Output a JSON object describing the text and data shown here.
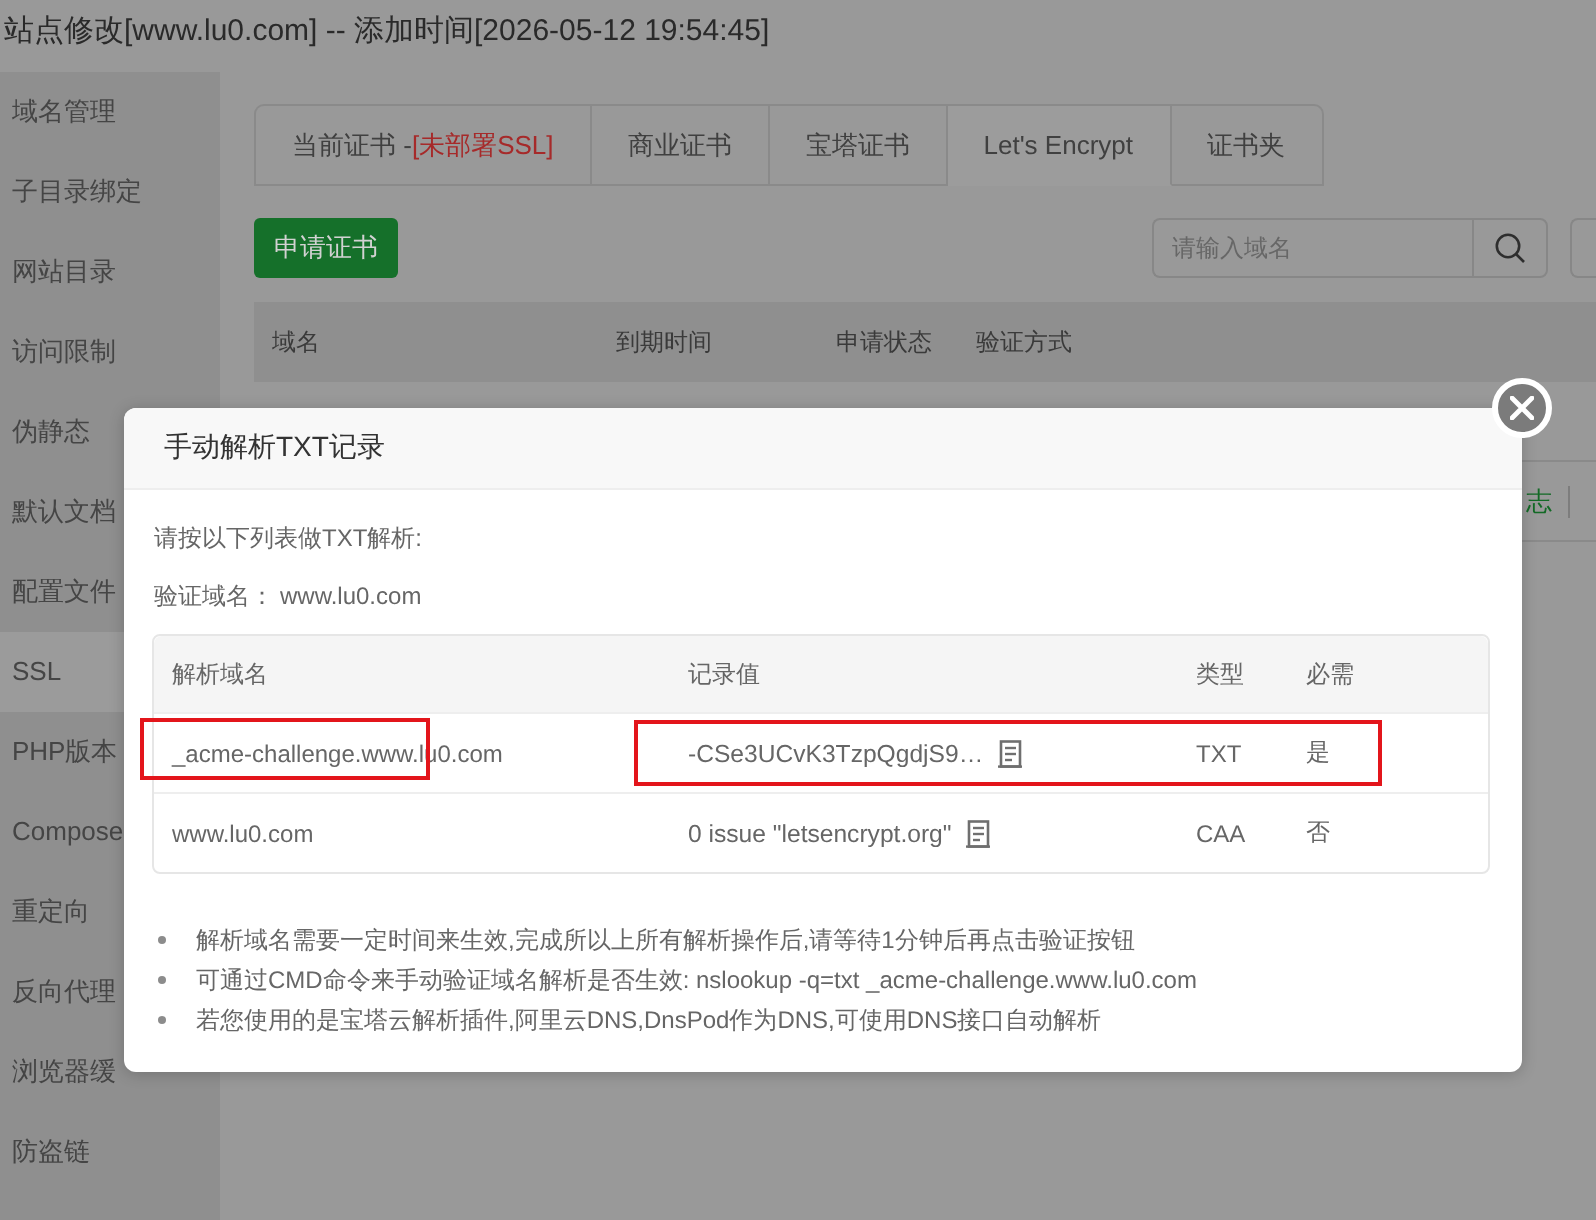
{
  "window": {
    "title": "站点修改[www.lu0.com] -- 添加时间[2026-05-12 19:54:45]"
  },
  "sidebar": {
    "items": [
      {
        "label": "域名管理",
        "selected": false
      },
      {
        "label": "子目录绑定",
        "selected": false
      },
      {
        "label": "网站目录",
        "selected": false
      },
      {
        "label": "访问限制",
        "selected": false
      },
      {
        "label": "伪静态",
        "selected": false
      },
      {
        "label": "默认文档",
        "selected": false
      },
      {
        "label": "配置文件",
        "selected": false
      },
      {
        "label": "SSL",
        "selected": true
      },
      {
        "label": "PHP版本",
        "selected": false
      },
      {
        "label": "Compose",
        "selected": false
      },
      {
        "label": "重定向",
        "selected": false
      },
      {
        "label": "反向代理",
        "selected": false
      },
      {
        "label": "浏览器缓",
        "selected": false
      },
      {
        "label": "防盗链",
        "selected": false
      }
    ]
  },
  "tabs": [
    {
      "label": "当前证书 -",
      "note": "[未部署SSL]",
      "selected": false
    },
    {
      "label": "商业证书",
      "selected": false
    },
    {
      "label": "宝塔证书",
      "selected": false
    },
    {
      "label": "Let's Encrypt",
      "selected": true
    },
    {
      "label": "证书夹",
      "selected": false
    }
  ],
  "toolbar": {
    "apply_button": "申请证书",
    "search": {
      "placeholder": "请输入域名"
    }
  },
  "table": {
    "columns": [
      "域名",
      "到期时间",
      "申请状态",
      "验证方式"
    ],
    "rows": [
      {
        "kind": "blank"
      },
      {
        "kind": "link",
        "text": "志"
      }
    ]
  },
  "dialog": {
    "title": "手动解析TXT记录",
    "intro": "请按以下列表做TXT解析:",
    "domain_label": "验证域名：",
    "domain": "www.lu0.com",
    "records": {
      "columns": [
        "解析域名",
        "记录值",
        "类型",
        "必需"
      ],
      "rows": [
        {
          "name": "_acme-challenge.www.lu0.com",
          "value": "-CSe3UCvK3TzpQgdjS9…",
          "type": "TXT",
          "required": "是",
          "highlighted": true
        },
        {
          "name": "www.lu0.com",
          "value": "0 issue \"letsencrypt.org\"",
          "type": "CAA",
          "required": "否",
          "highlighted": false
        }
      ]
    },
    "notes": [
      "解析域名需要一定时间来生效,完成所以上所有解析操作后,请等待1分钟后再点击验证按钮",
      "可通过CMD命令来手动验证域名解析是否生效: nslookup -q=txt _acme-challenge.www.lu0.com",
      "若您使用的是宝塔云解析插件,阿里云DNS,DnsPod作为DNS,可使用DNS接口自动解析"
    ]
  }
}
